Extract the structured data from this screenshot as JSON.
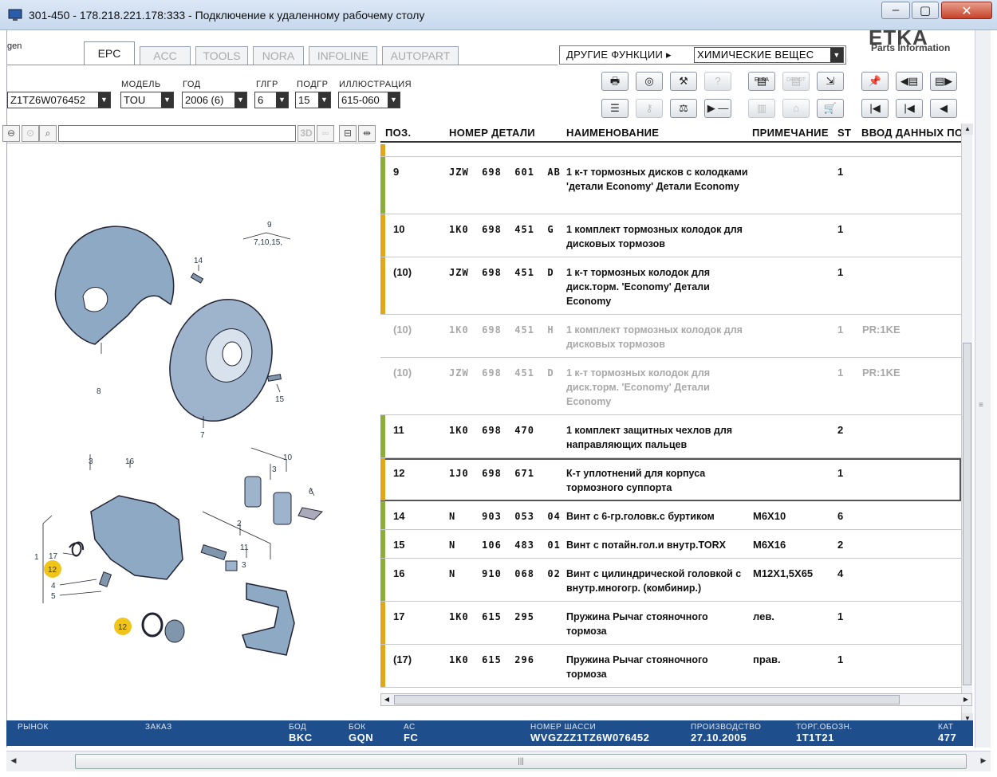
{
  "window": {
    "title": "301-450 - 178.218.221.178:333 - Подключение к удаленному рабочему столу",
    "min": "–",
    "max": "▢",
    "close": "✕"
  },
  "app": {
    "brand_fragment": "gen",
    "logo": "ETKA",
    "logo_sub": "Parts Information",
    "tabs": [
      {
        "label": "EPC",
        "active": true
      },
      {
        "label": "ACC"
      },
      {
        "label": "TOOLS"
      },
      {
        "label": "NORA"
      },
      {
        "label": "INFOLINE"
      },
      {
        "label": "AUTOPART"
      }
    ],
    "other_functions": {
      "label": "ДРУГИЕ ФУНКЦИИ ▸",
      "value": "ХИМИЧЕСКИЕ ВЕЩЕС"
    }
  },
  "selectors": {
    "vin": "Z1TZ6W076452",
    "model": {
      "label": "МОДЕЛЬ",
      "value": "TOU"
    },
    "year": {
      "label": "ГОД",
      "value": "2006 (6)"
    },
    "hgr": {
      "label": "ГЛГР",
      "value": "6"
    },
    "ugr": {
      "label": "ПОДГР",
      "value": "15"
    },
    "illustration": {
      "label": "ИЛЛЮСТРАЦИЯ",
      "value": "615-060"
    }
  },
  "toolbar": {
    "elsa": "ELSA",
    "depot": "DEPOT",
    "btn_3d": "3D"
  },
  "table": {
    "headers": {
      "pos": "ПОЗ.",
      "part": "НОМЕР ДЕТАЛИ",
      "name": "НАИМЕНОВАНИЕ",
      "note": "ПРИМЕЧАНИЕ",
      "st": "ST",
      "input": "ВВОД ДАННЫХ ПО"
    },
    "rows": [
      {
        "pos": "9",
        "pn": "JZW  698  601  AB",
        "name": "1 к-т тормозных дисков с колодками    'детали Economy' Детали Economy",
        "note": "",
        "st": "1",
        "inp": "",
        "bar": "#8aad3b",
        "h": 72
      },
      {
        "pos": "10",
        "pn": "1K0  698  451  G",
        "name": "1 комплект тормозных колодок для дисковых тормозов",
        "note": "",
        "st": "1",
        "inp": "",
        "bar": "#e0a61c",
        "h": 54
      },
      {
        "pos": "(10)",
        "pn": "JZW  698  451  D",
        "name": "1 к-т тормозных колодок для диск.торм.            'Economy' Детали Economy",
        "note": "",
        "st": "1",
        "inp": "",
        "bar": "#e0a61c",
        "h": 72
      },
      {
        "pos": "(10)",
        "pn": "1K0  698  451  H",
        "name": "1 комплект тормозных колодок для дисковых тормозов",
        "note": "",
        "st": "1",
        "inp": "PR:1KE",
        "grey": true,
        "h": 54
      },
      {
        "pos": "(10)",
        "pn": "JZW  698  451  D",
        "name": "1 к-т тормозных колодок для диск.торм.            'Economy' Детали Economy",
        "note": "",
        "st": "1",
        "inp": "PR:1KE",
        "grey": true,
        "h": 72
      },
      {
        "pos": "11",
        "pn": "1K0  698  470",
        "name": "1 комплект защитных чехлов для направляющих пальцев",
        "note": "",
        "st": "2",
        "inp": "",
        "bar": "#8aad3b",
        "h": 54
      },
      {
        "pos": "12",
        "pn": "1J0  698  671",
        "name": "К-т уплотнений для корпуса тормозного суппорта",
        "note": "",
        "st": "1",
        "inp": "",
        "bar": "#e0a61c",
        "h": 54,
        "selected": true
      },
      {
        "pos": "14",
        "pn": "N    903  053  04",
        "name": "Винт с 6-гр.головк.с буртиком",
        "note": "M6X10",
        "st": "6",
        "inp": "",
        "bar": "#8aad3b",
        "h": 36
      },
      {
        "pos": "15",
        "pn": "N    106  483  01",
        "name": "Винт с потайн.гол.и внутр.TORX",
        "note": "M6X16",
        "st": "2",
        "inp": "",
        "bar": "#8aad3b",
        "h": 36
      },
      {
        "pos": "16",
        "pn": "N    910  068  02",
        "name": "Винт с цилиндрической головкой с внутр.многогр. (комбинир.)",
        "note": "M12X1,5X65",
        "st": "4",
        "inp": "",
        "bar": "#8aad3b",
        "h": 54
      },
      {
        "pos": "17",
        "pn": "1K0  615  295",
        "name": "Пружина Рычаг стояночного тормоза",
        "note": "лев.",
        "st": "1",
        "inp": "",
        "bar": "#e0a61c",
        "h": 54
      },
      {
        "pos": "(17)",
        "pn": "1K0  615  296",
        "name": "Пружина Рычаг стояночного тормоза",
        "note": "прав.",
        "st": "1",
        "inp": "",
        "bar": "#e0a61c",
        "h": 54
      }
    ]
  },
  "illustration": {
    "labels": {
      "l9": "9",
      "l9sub": "7,10,15,",
      "l14": "14",
      "l8": "8",
      "l15": "15",
      "l7": "7",
      "l3a": "3",
      "l16": "16",
      "l10": "10",
      "l3b": "3",
      "l6": "6",
      "l2": "2",
      "l11": "11",
      "l3c": "3",
      "l1": "1",
      "l17": "17",
      "l12a": "12",
      "l4": "4",
      "l5": "5",
      "l12b": "12"
    }
  },
  "status": {
    "market": {
      "label": "РЫНОК",
      "value": ""
    },
    "order": {
      "label": "ЗАКАЗ",
      "value": ""
    },
    "bod": {
      "label": "БОД",
      "value": "BKC"
    },
    "bok": {
      "label": "БОК",
      "value": "GQN"
    },
    "ac": {
      "label": "АС",
      "value": "FC"
    },
    "chassis": {
      "label": "НОМЕР ШАССИ",
      "value": "WVGZZZ1TZ6W076452"
    },
    "production": {
      "label": "ПРОИЗВОДСТВО",
      "value": "27.10.2005"
    },
    "trade": {
      "label": "ТОРГ.ОБОЗН.",
      "value": "1T1T21"
    },
    "cat": {
      "label": "КАТ",
      "value": "477"
    }
  },
  "colors": {
    "status_bar": "#1f4e8c",
    "green_bar": "#8aad3b",
    "yellow_bar": "#e0a61c",
    "callout": "#f0c419"
  }
}
